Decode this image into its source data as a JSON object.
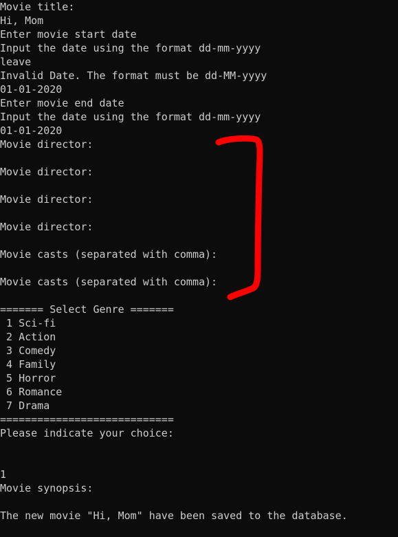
{
  "console": {
    "lines": [
      "Movie title:",
      "Hi, Mom",
      "Enter movie start date",
      "Input the date using the format dd-mm-yyyy",
      "leave",
      "Invalid Date. The format must be dd-MM-yyyy",
      "01-01-2020",
      "Enter movie end date",
      "Input the date using the format dd-mm-yyyy",
      "01-01-2020",
      "Movie director:",
      "",
      "Movie director:",
      "",
      "Movie director:",
      "",
      "Movie director:",
      "",
      "Movie casts (separated with comma):",
      "",
      "Movie casts (separated with comma):",
      "",
      "======= Select Genre =======",
      " 1 Sci-fi",
      " 2 Action",
      " 3 Comedy",
      " 4 Family",
      " 5 Horror",
      " 6 Romance",
      " 7 Drama",
      "============================",
      "Please indicate your choice:",
      "",
      "",
      "1",
      "Movie synopsis:",
      "",
      "The new movie \"Hi, Mom\" have been saved to the database."
    ]
  },
  "annotation": {
    "color": "#ff0000",
    "shape": "bracket"
  }
}
